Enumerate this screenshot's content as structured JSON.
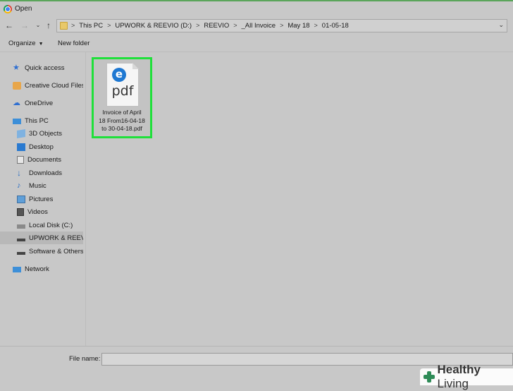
{
  "window": {
    "title": "Open"
  },
  "nav": {
    "crumbs": [
      "This PC",
      "UPWORK & REEVIO (D:)",
      "REEVIO",
      "_All Invoice",
      "May 18",
      "01-05-18"
    ]
  },
  "toolbar": {
    "organize_label": "Organize",
    "new_folder_label": "New folder"
  },
  "sidebar": {
    "items": [
      {
        "label": "Quick access",
        "icon": "star-icon"
      },
      {
        "label": "Creative Cloud Files",
        "icon": "creative-cloud-icon"
      },
      {
        "label": "OneDrive",
        "icon": "cloud-icon"
      },
      {
        "label": "This PC",
        "icon": "computer-icon"
      },
      {
        "label": "3D Objects",
        "icon": "cube-icon"
      },
      {
        "label": "Desktop",
        "icon": "desktop-icon"
      },
      {
        "label": "Documents",
        "icon": "document-icon"
      },
      {
        "label": "Downloads",
        "icon": "download-arrow-icon"
      },
      {
        "label": "Music",
        "icon": "music-note-icon"
      },
      {
        "label": "Pictures",
        "icon": "picture-icon"
      },
      {
        "label": "Videos",
        "icon": "video-icon"
      },
      {
        "label": "Local Disk (C:)",
        "icon": "drive-icon"
      },
      {
        "label": "UPWORK & REEVIO",
        "icon": "drive-icon"
      },
      {
        "label": "Software & Others (",
        "icon": "drive-icon"
      },
      {
        "label": "Network",
        "icon": "network-icon"
      }
    ]
  },
  "file": {
    "name_line1": "Invoice of April",
    "name_line2": "18 From16-04-18",
    "name_line3": "to 30-04-18.pdf",
    "type_text": "pdf",
    "edge_letter": "e"
  },
  "bottom": {
    "filename_label": "File name:",
    "filename_value": ""
  },
  "watermark": {
    "text_bold": "Healthy",
    "text_thin": " Living"
  }
}
